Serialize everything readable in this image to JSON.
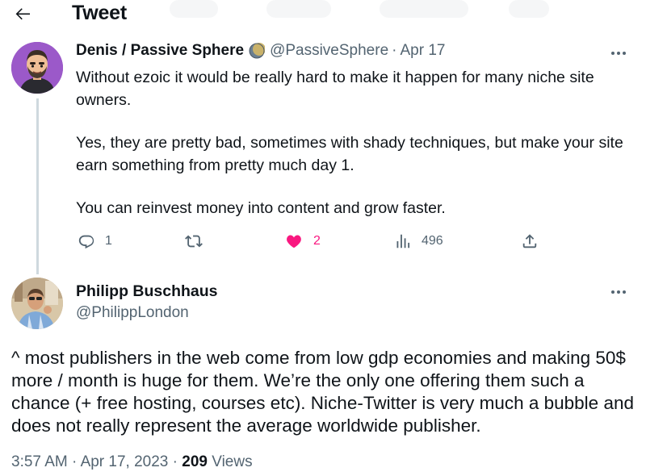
{
  "header": {
    "title": "Tweet"
  },
  "reply_tweet": {
    "author_name": "Denis / Passive Sphere",
    "handle": "@PassiveSphere",
    "separator": "·",
    "date": "Apr 17",
    "paragraphs": [
      "Without ezoic it would be really hard to make it happen for many niche site owners.",
      "Yes, they are pretty bad, sometimes with shady techniques, but make your site earn something from pretty much day 1.",
      "You can reinvest money into content and grow faster."
    ],
    "actions": {
      "replies": "1",
      "likes": "2",
      "views": "496"
    }
  },
  "main_tweet": {
    "author_name": "Philipp Buschhaus",
    "handle": "@PhilippLondon",
    "text": "^ most publishers in the web come from low gdp economies and making 50$ more / month is huge for them. We’re the only one offering them such a chance (+ free hosting, courses etc). Niche-Twitter is very much a bubble and does not really represent the average worldwide publisher.",
    "time": "3:57 AM",
    "separator": "·",
    "date": "Apr 17, 2023",
    "views_count": "209",
    "views_label": "Views"
  },
  "colors": {
    "text": "#0f1419",
    "secondary": "#536471",
    "like": "#f91880",
    "thread_line": "#cfd9de"
  },
  "icons": [
    "back-arrow-icon",
    "more-icon",
    "reply-icon",
    "retweet-icon",
    "heart-icon",
    "views-icon",
    "share-icon",
    "moon-badge-icon"
  ]
}
